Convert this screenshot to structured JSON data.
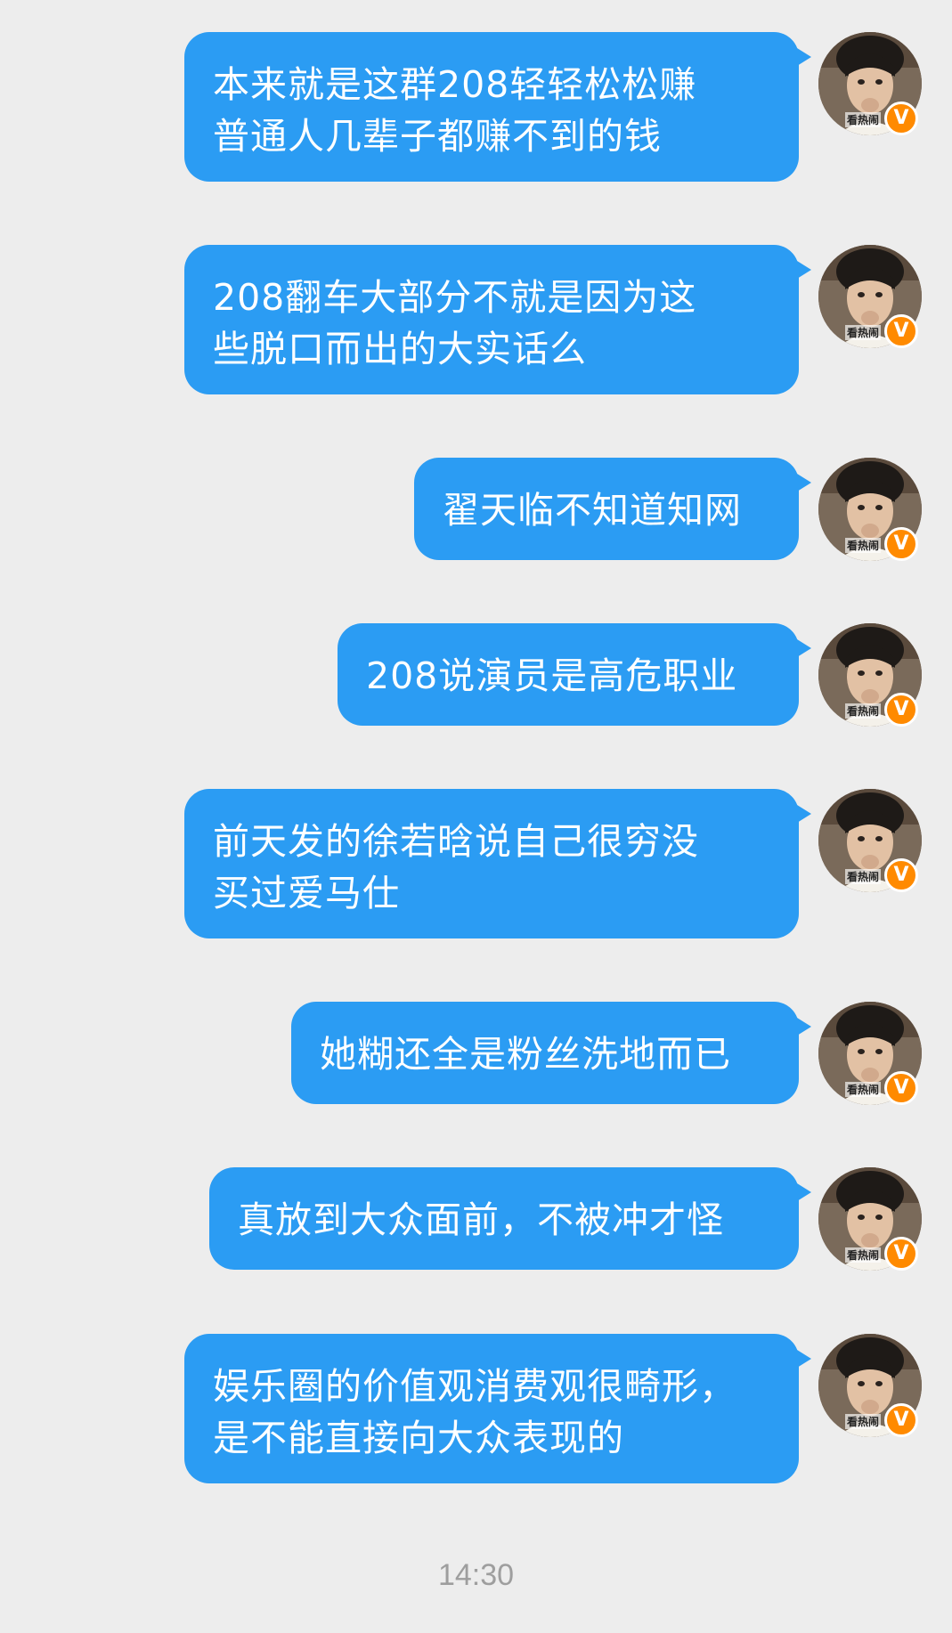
{
  "messages": [
    {
      "lines": [
        "本来就是这群208轻轻松松赚",
        "普通人几辈子都赚不到的钱"
      ]
    },
    {
      "lines": [
        "208翻车大部分不就是因为这",
        "些脱口而出的大实话么"
      ]
    },
    {
      "lines": [
        "翟天临不知道知网"
      ]
    },
    {
      "lines": [
        "208说演员是高危职业"
      ]
    },
    {
      "lines": [
        "前天发的徐若晗说自己很穷没",
        "买过爱马仕"
      ]
    },
    {
      "lines": [
        "她糊还全是粉丝洗地而已"
      ]
    },
    {
      "lines": [
        "真放到大众面前，不被冲才怪"
      ]
    },
    {
      "lines": [
        "娱乐圈的价值观消费观很畸形，",
        "是不能直接向大众表现的"
      ]
    }
  ],
  "avatar": {
    "watermark": "看热闹",
    "badge": "V",
    "icon": "verified-v-badge-icon"
  },
  "timestamp": "14:30",
  "colors": {
    "background": "#ededed",
    "bubble": "#2b9cf3",
    "bubble_text": "#ffffff",
    "badge": "#ff8a00",
    "timestamp": "#9e9e9e"
  }
}
